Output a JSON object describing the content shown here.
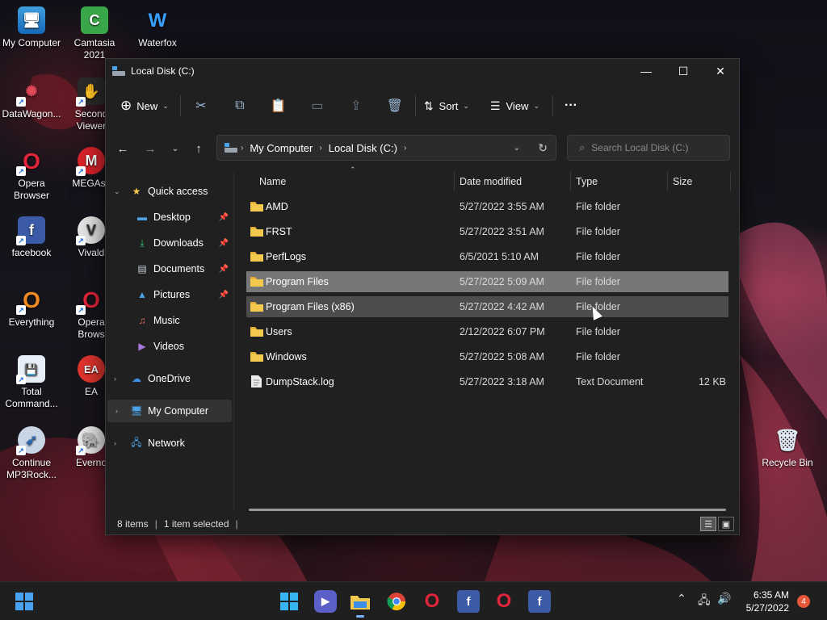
{
  "desktop": {
    "icons": [
      {
        "label": "My Computer",
        "icon": "monitor-icon"
      },
      {
        "label": "Camtasia 2021",
        "icon": "camtasia-icon"
      },
      {
        "label": "Waterfox",
        "icon": "waterfox-icon"
      },
      {
        "label": "DataWagon...",
        "icon": "datawagon-icon"
      },
      {
        "label": "Second Viewer",
        "icon": "second-viewer-icon"
      },
      {
        "label": "Opera Browser",
        "icon": "opera-icon"
      },
      {
        "label": "MEGAsy",
        "icon": "mega-icon"
      },
      {
        "label": "facebook",
        "icon": "facebook-icon"
      },
      {
        "label": "Vivald",
        "icon": "vivaldi-icon"
      },
      {
        "label": "Everything",
        "icon": "everything-icon"
      },
      {
        "label": "Opera Brows",
        "icon": "opera-gx-icon"
      },
      {
        "label": "Total Command...",
        "icon": "total-commander-icon"
      },
      {
        "label": "EA",
        "icon": "ea-icon"
      },
      {
        "label": "Continue MP3Rock...",
        "icon": "mp3rocket-icon"
      },
      {
        "label": "Everno",
        "icon": "evernote-icon"
      },
      {
        "label": "Recycle Bin",
        "icon": "recycle-bin-icon"
      }
    ]
  },
  "window": {
    "title": "Local Disk (C:)",
    "controls": {
      "minimize": "—",
      "maximize": "☐",
      "close": "✕"
    }
  },
  "toolbar": {
    "new_label": "New",
    "sort_label": "Sort",
    "view_label": "View",
    "more_label": "···"
  },
  "address": {
    "crumbs": [
      "My Computer",
      "Local Disk (C:)"
    ],
    "search_placeholder": "Search Local Disk (C:)"
  },
  "navpane": {
    "quick_access": "Quick access",
    "items": [
      {
        "label": "Desktop",
        "pinned": true
      },
      {
        "label": "Downloads",
        "pinned": true
      },
      {
        "label": "Documents",
        "pinned": true
      },
      {
        "label": "Pictures",
        "pinned": true
      },
      {
        "label": "Music",
        "pinned": false
      },
      {
        "label": "Videos",
        "pinned": false
      }
    ],
    "onedrive": "OneDrive",
    "my_computer": "My Computer",
    "network": "Network"
  },
  "columns": {
    "name": "Name",
    "date": "Date modified",
    "type": "Type",
    "size": "Size"
  },
  "files": [
    {
      "name": "AMD",
      "date": "5/27/2022 3:55 AM",
      "type": "File folder",
      "size": ""
    },
    {
      "name": "FRST",
      "date": "5/27/2022 3:51 AM",
      "type": "File folder",
      "size": ""
    },
    {
      "name": "PerfLogs",
      "date": "6/5/2021 5:10 AM",
      "type": "File folder",
      "size": ""
    },
    {
      "name": "Program Files",
      "date": "5/27/2022 5:09 AM",
      "type": "File folder",
      "size": ""
    },
    {
      "name": "Program Files (x86)",
      "date": "5/27/2022 4:42 AM",
      "type": "File folder",
      "size": ""
    },
    {
      "name": "Users",
      "date": "2/12/2022 6:07 PM",
      "type": "File folder",
      "size": ""
    },
    {
      "name": "Windows",
      "date": "5/27/2022 5:08 AM",
      "type": "File folder",
      "size": ""
    },
    {
      "name": "DumpStack.log",
      "date": "5/27/2022 3:18 AM",
      "type": "Text Document",
      "size": "12 KB"
    }
  ],
  "status": {
    "count": "8 items",
    "selected": "1 item selected"
  },
  "taskbar": {
    "time": "6:35 AM",
    "date": "5/27/2022",
    "notifications": "4"
  },
  "colors": {
    "accent": "#7ab3ff",
    "folder": "#f2c94c",
    "selection": "#777777"
  }
}
